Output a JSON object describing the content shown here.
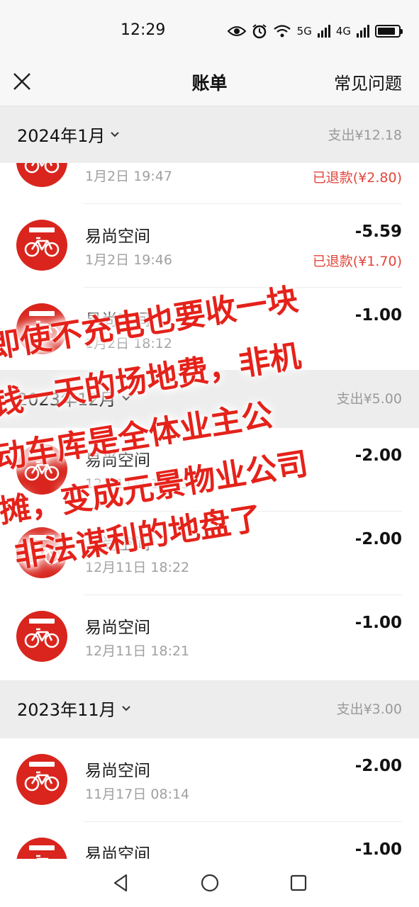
{
  "status_bar": {
    "time": "12:29",
    "icons": [
      "eye-icon",
      "alarm-icon",
      "wifi-icon",
      "5g-signal-icon",
      "4g-signal-icon",
      "battery-icon"
    ],
    "net_label_1": "5G",
    "net_label_2": "4G"
  },
  "nav": {
    "title": "账单",
    "faq_label": "常见问题"
  },
  "months": [
    {
      "label": "2024年1月",
      "total": "支出¥12.18",
      "items": [
        {
          "time": "1月2日 19:47",
          "refund": "已退款(¥2.80)"
        },
        {
          "merchant": "易尚空间",
          "time": "1月2日 19:46",
          "amount": "-5.59",
          "refund": "已退款(¥1.70)"
        },
        {
          "merchant": "易尚空间",
          "time": "1月2日 18:12",
          "amount": "-1.00"
        }
      ]
    },
    {
      "label": "2023年12月",
      "total": "支出¥5.00",
      "items": [
        {
          "merchant": "易尚空间",
          "time": "12月11日 18:23",
          "amount": "-2.00"
        },
        {
          "merchant": "易尚空间",
          "time": "12月11日 18:22",
          "amount": "-2.00"
        },
        {
          "merchant": "易尚空间",
          "time": "12月11日 18:21",
          "amount": "-1.00"
        }
      ]
    },
    {
      "label": "2023年11月",
      "total": "支出¥3.00",
      "items": [
        {
          "merchant": "易尚空间",
          "time": "11月17日 08:14",
          "amount": "-2.00"
        },
        {
          "merchant": "易尚空间",
          "amount": "-1.00"
        }
      ]
    }
  ],
  "overlay_text": [
    "即使不充电也要收一块",
    "钱一天的场地费，非机",
    "动车库是全体业主公",
    "摊，变成元景物业公司",
    "非法谋利的地盘了"
  ],
  "colors": {
    "brand_red": "#d9251d",
    "refund_red": "#e2453a",
    "overlay_red": "#e4221a",
    "header_gray": "#ededed"
  }
}
